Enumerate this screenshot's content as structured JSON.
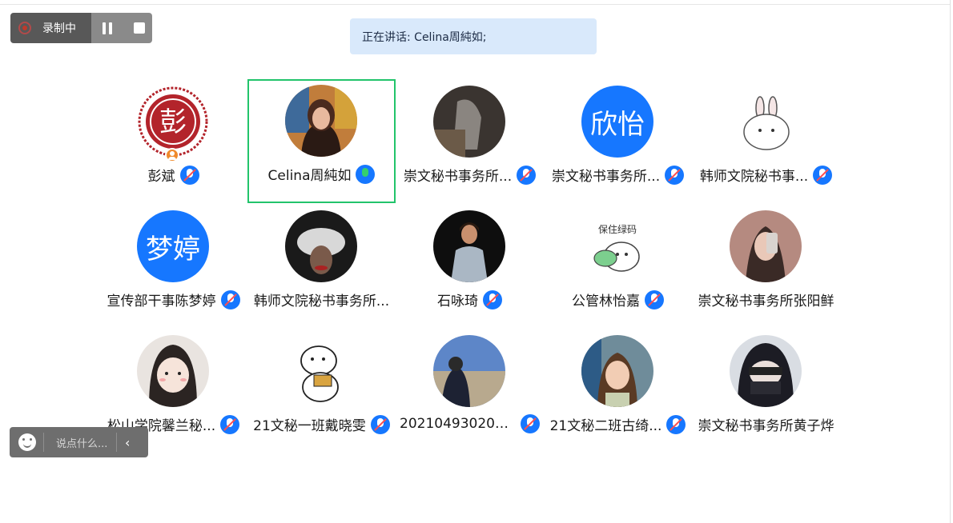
{
  "recording": {
    "label": "录制中"
  },
  "speaking": {
    "text": "正在讲话: Celina周純如;"
  },
  "participants": [
    {
      "name": "彭斌",
      "avatar": "seal-peng",
      "host": true,
      "mic": "muted"
    },
    {
      "name": "Celina周純如",
      "avatar": "photo",
      "mic": "speaking",
      "active": true
    },
    {
      "name": "崇文秘书事务所...",
      "avatar": "photo",
      "mic": "muted"
    },
    {
      "name": "崇文秘书事务所...",
      "avatar_text": "欣怡",
      "mic": "muted"
    },
    {
      "name": "韩师文院秘书事...",
      "avatar": "bunny",
      "mic": "muted"
    },
    {
      "name": "宣传部干事陈梦婷",
      "avatar_text": "梦婷",
      "mic": "muted"
    },
    {
      "name": "韩师文院秘书事务所...",
      "avatar": "photo",
      "mic": "none"
    },
    {
      "name": "石咏琦",
      "avatar": "photo",
      "mic": "muted"
    },
    {
      "name": "公管林怡嘉",
      "avatar": "sticker",
      "mic": "muted"
    },
    {
      "name": "崇文秘书事务所张阳鲜",
      "avatar": "photo",
      "mic": "none"
    },
    {
      "name": "松山学院馨兰秘...",
      "avatar": "cartoon",
      "mic": "muted"
    },
    {
      "name": "21文秘一班戴晓雯",
      "avatar": "bear",
      "mic": "muted"
    },
    {
      "name": "202104930201...",
      "avatar": "photo",
      "mic": "muted"
    },
    {
      "name": "21文秘二班古绮...",
      "avatar": "photo",
      "mic": "muted"
    },
    {
      "name": "崇文秘书事务所黄子烨",
      "avatar": "cartoon",
      "mic": "none"
    }
  ],
  "avatar_labels": {
    "peng": "彭",
    "sticker": "保住绿码"
  },
  "chat": {
    "placeholder": "说点什么..."
  },
  "colors": {
    "accent": "#1677ff",
    "active_border": "#22c46b"
  }
}
